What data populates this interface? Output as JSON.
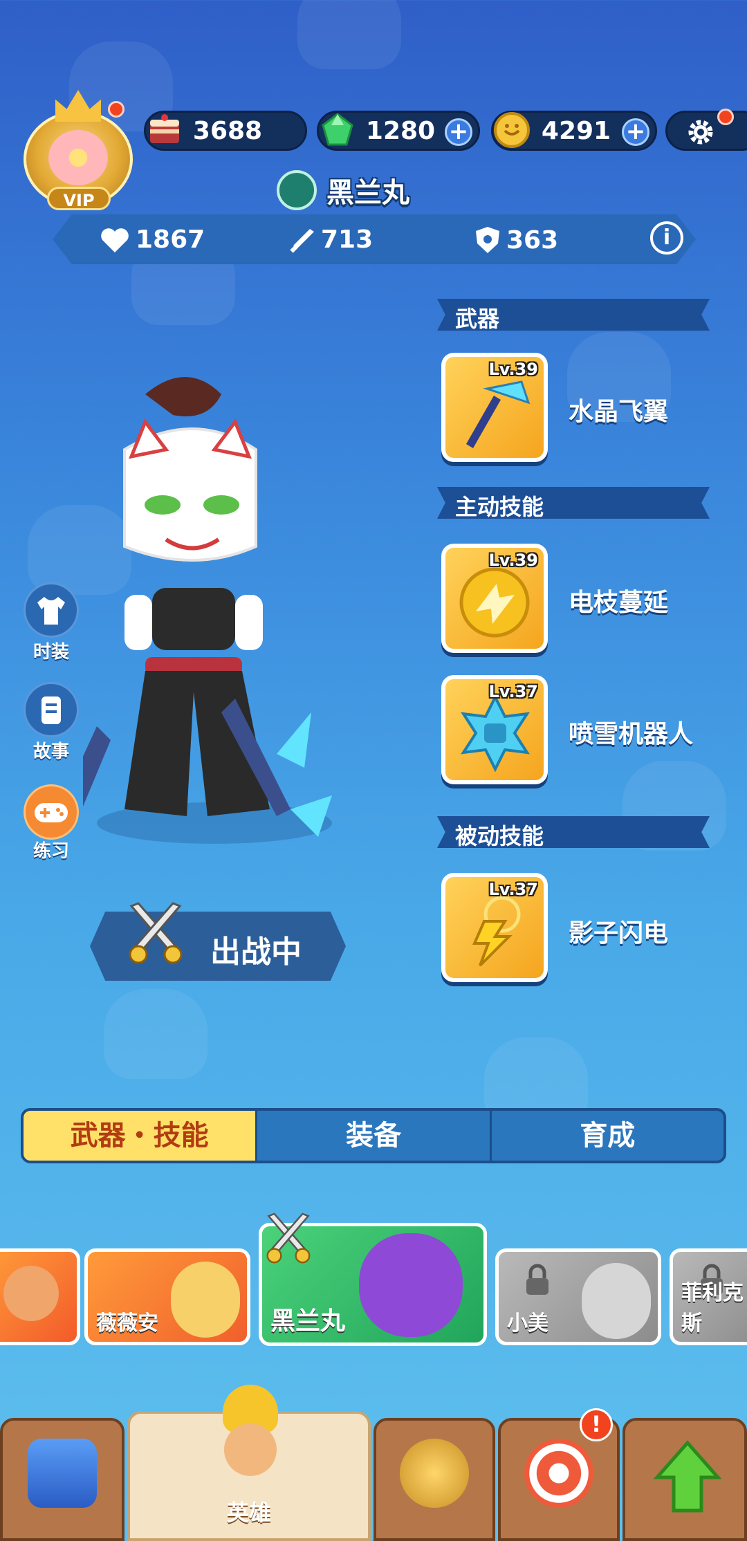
{
  "header": {
    "vip_label": "VIP",
    "currencies": [
      {
        "name": "cake",
        "value": "3688",
        "has_plus": false
      },
      {
        "name": "gem",
        "value": "1280",
        "has_plus": true
      },
      {
        "name": "coin",
        "value": "4291",
        "has_plus": true
      }
    ],
    "plus_symbol": "+",
    "hero_name": "黑兰丸"
  },
  "stats": {
    "health": "1867",
    "attack": "713",
    "defense": "363",
    "info_symbol": "i"
  },
  "loadout": {
    "weapon_header": "武器",
    "active_header": "主动技能",
    "passive_header": "被动技能",
    "weapon": {
      "name": "水晶飞翼",
      "level": "Lv.39"
    },
    "active_skills": [
      {
        "name": "电枝蔓延",
        "level": "Lv.39"
      },
      {
        "name": "喷雪机器人",
        "level": "Lv.37"
      }
    ],
    "passive_skill": {
      "name": "影子闪电",
      "level": "Lv.37"
    }
  },
  "side_menu": {
    "costume": "时装",
    "story": "故事",
    "practice": "练习"
  },
  "battle_status": "出战中",
  "tabs": [
    "武器・技能",
    "装备",
    "育成"
  ],
  "heroes": [
    {
      "name": ""
    },
    {
      "name": "薇薇安"
    },
    {
      "name": "黑兰丸"
    },
    {
      "name": "小美"
    },
    {
      "name": "菲利克斯"
    }
  ],
  "bottom_nav": {
    "hero_label": "英雄",
    "badge": "!"
  },
  "colors": {
    "active_tab": "#ffe16a",
    "active_tab_text": "#b23c12",
    "notification": "#f2431f"
  }
}
